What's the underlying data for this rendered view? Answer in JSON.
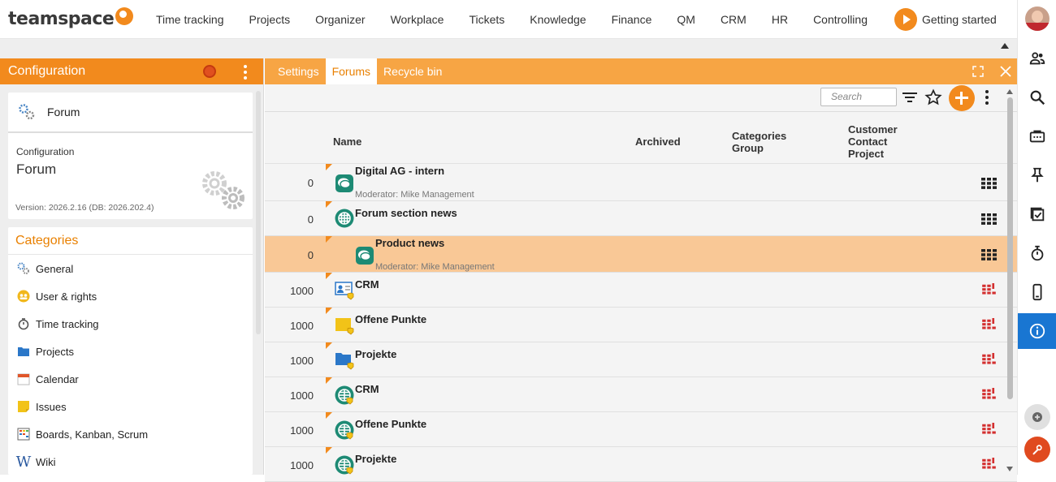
{
  "app": {
    "logo_text": "teamspace"
  },
  "nav": {
    "items": [
      "Time tracking",
      "Projects",
      "Organizer",
      "Workplace",
      "Tickets",
      "Knowledge",
      "Finance",
      "QM",
      "CRM",
      "HR",
      "Controlling"
    ],
    "getting_started": "Getting started"
  },
  "left": {
    "header": "Configuration",
    "card_label": "Forum",
    "config_small": "Configuration",
    "config_big": "Forum",
    "version": "Version: 2026.2.16 (DB: 2026.202.4)",
    "categories_title": "Categories",
    "categories": [
      "General",
      "User & rights",
      "Time tracking",
      "Projects",
      "Calendar",
      "Issues",
      "Boards, Kanban, Scrum",
      "Wiki"
    ]
  },
  "tabs": [
    "Settings",
    "Forums",
    "Recycle bin"
  ],
  "active_tab": "Forums",
  "toolbar": {
    "search_placeholder": "Search"
  },
  "columns": {
    "name": "Name",
    "archived": "Archived",
    "categories": "Categories",
    "group": "Group",
    "customer": "Customer",
    "contact": "Contact",
    "project": "Project"
  },
  "rows": [
    {
      "num": "0",
      "name": "Digital AG - intern",
      "moderator": "Moderator: Mike Management",
      "icon": "chat-bubble-icon",
      "indent": false,
      "highlight": false,
      "status": "grid"
    },
    {
      "num": "0",
      "name": "Forum section news",
      "moderator": "",
      "icon": "globe-icon",
      "indent": false,
      "highlight": false,
      "status": "grid"
    },
    {
      "num": "0",
      "name": "Product news",
      "moderator": "Moderator: Mike Management",
      "icon": "chat-bubble-icon",
      "indent": true,
      "highlight": true,
      "status": "grid"
    },
    {
      "num": "1000",
      "name": "CRM",
      "moderator": "",
      "icon": "contact-card-icon",
      "indent": false,
      "highlight": false,
      "status": "grid-alert"
    },
    {
      "num": "1000",
      "name": "Offene Punkte",
      "moderator": "",
      "icon": "sticky-note-icon",
      "indent": false,
      "highlight": false,
      "status": "grid-alert"
    },
    {
      "num": "1000",
      "name": "Projekte",
      "moderator": "",
      "icon": "folder-icon",
      "indent": false,
      "highlight": false,
      "status": "grid-alert"
    },
    {
      "num": "1000",
      "name": "CRM",
      "moderator": "",
      "icon": "globe-icon",
      "indent": false,
      "highlight": false,
      "status": "grid-alert"
    },
    {
      "num": "1000",
      "name": "Offene Punkte",
      "moderator": "",
      "icon": "globe-icon",
      "indent": false,
      "highlight": false,
      "status": "grid-alert"
    },
    {
      "num": "1000",
      "name": "Projekte",
      "moderator": "",
      "icon": "globe-icon",
      "indent": false,
      "highlight": false,
      "status": "grid-alert"
    }
  ],
  "colors": {
    "accent": "#f28a1d",
    "tab_bar": "#f7a544",
    "highlight_row": "#f9c896",
    "info_active": "#1976d2",
    "alert_red": "#d32f2f"
  }
}
